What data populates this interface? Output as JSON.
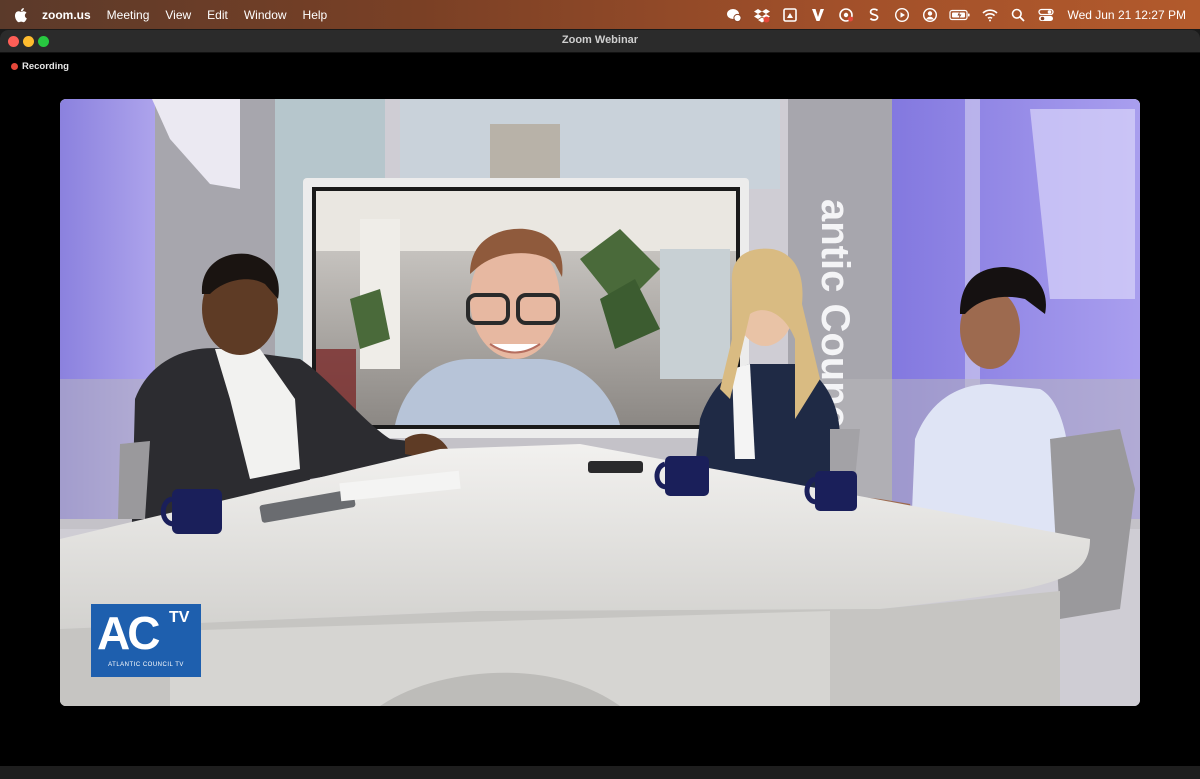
{
  "menubar": {
    "app_name": "zoom.us",
    "menus": [
      "Meeting",
      "View",
      "Edit",
      "Window",
      "Help"
    ],
    "tray_icons": [
      "wechat-icon",
      "dropbox-icon",
      "drive-icon",
      "v-icon",
      "sync-icon",
      "s-icon",
      "play-icon",
      "user-icon",
      "battery-icon",
      "wifi-icon",
      "search-icon",
      "control-center-icon"
    ],
    "clock": "Wed Jun 21  12:27 PM"
  },
  "window": {
    "title": "Zoom Webinar",
    "recording_label": "Recording"
  },
  "video": {
    "backdrop_text": "antic Council",
    "logo_main": "AC",
    "logo_tv": "TV",
    "logo_subtitle": "ATLANTIC COUNCIL TV"
  },
  "colors": {
    "recording_dot": "#e5483a",
    "logo_blue": "#1e5fae",
    "backdrop_purple": "#8f86e6"
  }
}
